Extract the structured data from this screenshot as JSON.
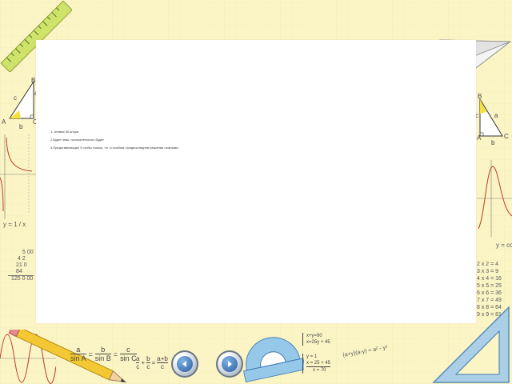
{
  "slide": {
    "lines": [
      "1. Атовая 30 штуки",
      "2.Будет знак. положительного будет",
      "3.Представляющих 3 чтобы только, т.е. и особым: предпоследнем решения ложными"
    ]
  },
  "decor": {
    "triangle_left": {
      "vertices": [
        "B",
        "A",
        "C"
      ],
      "sides": [
        "c",
        "a",
        "b"
      ]
    },
    "triangle_right": {
      "vertices": [
        "B",
        "A",
        "C"
      ],
      "sides": [
        "c",
        "a",
        "b"
      ]
    },
    "graph_left_label": "y = 1 / x",
    "graph_right_label": "y = co",
    "arithmetic": [
      "5 00",
      "4 2",
      "21 0",
      "84",
      "125 0 00"
    ],
    "times_table": [
      "2 x 2 = 4",
      "3 x 3 = 9",
      "4 x 4 = 16",
      "5 x 5 = 25",
      "6 x 6 = 36",
      "7 x 7 = 49",
      "8 x 8 = 64",
      "9 x 9 = 81"
    ],
    "law_of_sines": {
      "a": "a",
      "b": "b",
      "c": "c",
      "sinA": "sin A",
      "sinB": "sin B",
      "sinC": "sin C"
    },
    "fraction_sum": {
      "a": "a",
      "b": "b",
      "c": "c",
      "ab": "a+b"
    },
    "system1": [
      "x+y=90",
      "x=25y + 45"
    ],
    "system2": [
      "y = 1",
      "x = 25 + 45",
      "x = 70"
    ],
    "identity": "(a+y)(a-y) = a² - y²"
  },
  "nav": {
    "prev_label": "Previous slide",
    "next_label": "Next slide"
  },
  "colors": {
    "background": "#fbf6c9",
    "ruler": "#cfe36a",
    "pencil": "#f3c832",
    "button": "#2a5f9e"
  }
}
